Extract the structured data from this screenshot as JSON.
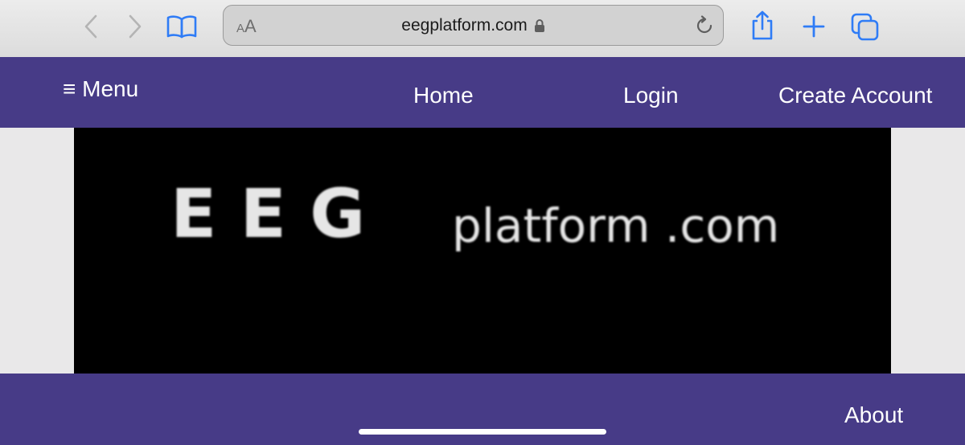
{
  "browser": {
    "text_size_label_small": "A",
    "text_size_label_large": "A",
    "url": "eegplatform.com",
    "icons": {
      "back": "chevron-left-icon",
      "forward": "chevron-right-icon",
      "bookmarks": "book-icon",
      "lock": "lock-icon",
      "reload": "reload-icon",
      "share": "share-icon",
      "new_tab": "plus-icon",
      "tabs": "tabs-icon"
    },
    "accent_color": "#2f7cf6"
  },
  "nav": {
    "menu_label": "≡ Menu",
    "home": "Home",
    "login": "Login",
    "create_account": "Create Account",
    "background_color": "#473b87"
  },
  "hero": {
    "logo_main": "E E G",
    "logo_suffix": "platform .com"
  },
  "footer": {
    "about": "About"
  }
}
